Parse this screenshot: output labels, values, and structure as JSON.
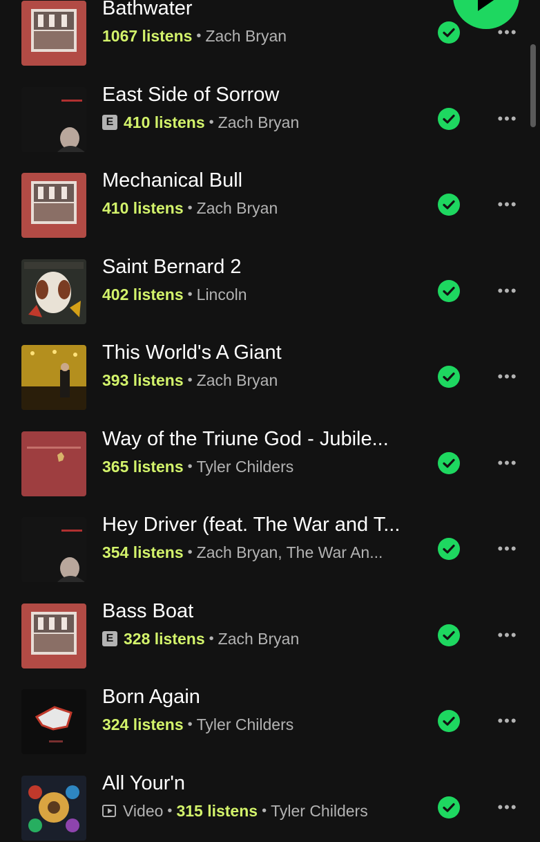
{
  "colors": {
    "background": "#121212",
    "listens": "#d3f36b",
    "accent": "#1ed760",
    "secondary": "#b3b3b3"
  },
  "tracks": [
    {
      "title": "Bathwater",
      "listens": "1067 listens",
      "artist": "Zach Bryan",
      "explicit": false,
      "video": false,
      "art": "red-album-art"
    },
    {
      "title": "East Side of Sorrow",
      "listens": "410 listens",
      "artist": "Zach Bryan",
      "explicit": true,
      "video": false,
      "art": "dark-portrait-art"
    },
    {
      "title": "Mechanical Bull",
      "listens": "410 listens",
      "artist": "Zach Bryan",
      "explicit": false,
      "video": false,
      "art": "red-album-art"
    },
    {
      "title": "Saint Bernard 2",
      "listens": "402 listens",
      "artist": "Lincoln",
      "explicit": false,
      "video": false,
      "art": "saint-bernard-art"
    },
    {
      "title": "This World's A Giant",
      "listens": "393 listens",
      "artist": "Zach Bryan",
      "explicit": false,
      "video": false,
      "art": "bar-photo-art"
    },
    {
      "title": "Way of the Triune God - Jubile...",
      "listens": "365 listens",
      "artist": "Tyler Childers",
      "explicit": false,
      "video": false,
      "art": "maroon-album-art"
    },
    {
      "title": "Hey Driver (feat. The War and T...",
      "listens": "354 listens",
      "artist": "Zach Bryan, The War An...",
      "explicit": false,
      "video": false,
      "art": "dark-portrait-art"
    },
    {
      "title": "Bass Boat",
      "listens": "328 listens",
      "artist": "Zach Bryan",
      "explicit": true,
      "video": false,
      "art": "red-album-art"
    },
    {
      "title": "Born Again",
      "listens": "324 listens",
      "artist": "Tyler Childers",
      "explicit": false,
      "video": false,
      "art": "born-again-art"
    },
    {
      "title": "All Your'n",
      "listens": "315 listens",
      "artist": "Tyler Childers",
      "explicit": false,
      "video": true,
      "video_label": "Video",
      "art": "colorful-art"
    }
  ],
  "labels": {
    "explicit_badge": "E",
    "more": "•••"
  },
  "icons": {
    "check": "check-circle-icon",
    "more": "more-options-icon",
    "play": "play-icon",
    "video": "video-icon"
  }
}
